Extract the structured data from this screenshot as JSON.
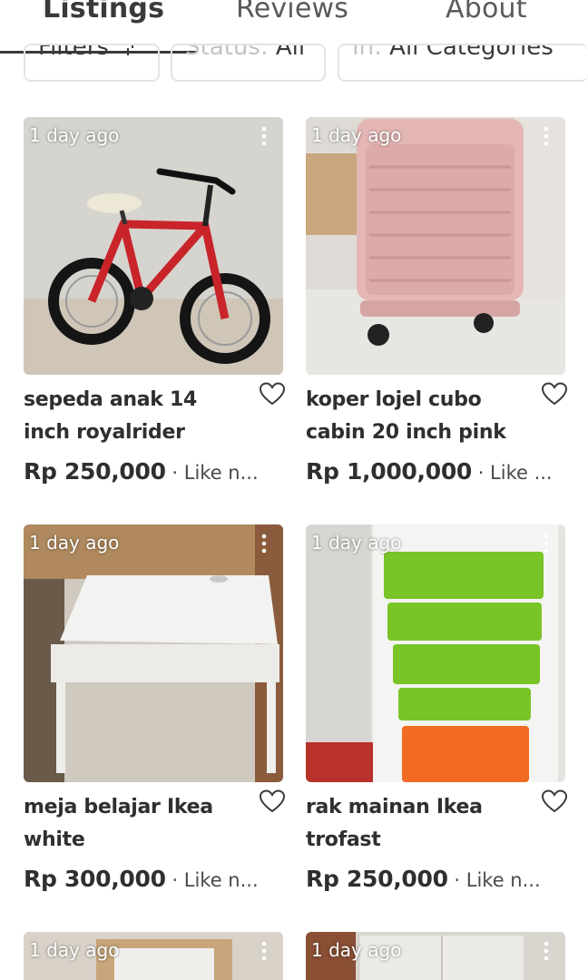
{
  "tabs": {
    "listings": "Listings",
    "reviews": "Reviews",
    "about": "About"
  },
  "filters": {
    "filters_label": "Filters",
    "status_prefix": "Status:",
    "status_value": "All",
    "category_prefix": "In:",
    "category_value": "All Categories"
  },
  "listings": [
    {
      "time": "1 day ago",
      "title": "sepeda anak 14 inch royalrider",
      "price": "Rp 250,000",
      "meta": " · Like n..."
    },
    {
      "time": "1 day ago",
      "title": "koper lojel cubo cabin 20 inch pink",
      "price": "Rp 1,000,000",
      "meta": " · Like ..."
    },
    {
      "time": "1 day ago",
      "title": "meja belajar Ikea white",
      "price": "Rp 300,000",
      "meta": " · Like n..."
    },
    {
      "time": "1 day ago",
      "title": "rak mainan Ikea trofast",
      "price": "Rp 250,000",
      "meta": " · Like n..."
    },
    {
      "time": "1 day ago"
    },
    {
      "time": "1 day ago"
    }
  ]
}
